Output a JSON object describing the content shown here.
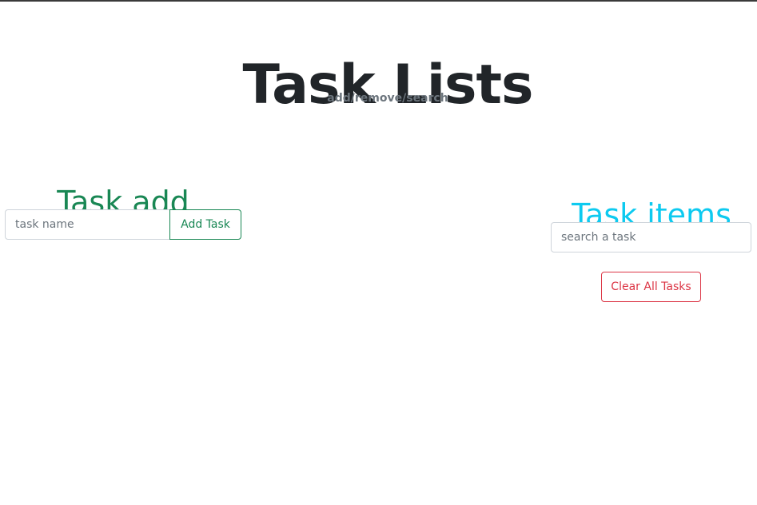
{
  "header": {
    "title": "Task Lists",
    "subtitle": "add/remove/search"
  },
  "add_section": {
    "title": "Task add",
    "input_placeholder": "task name",
    "input_value": "",
    "button_label": "Add Task"
  },
  "items_section": {
    "title": "Task items",
    "search_placeholder": "search a task",
    "search_value": "",
    "clear_button_label": "Clear All Tasks",
    "tasks": []
  },
  "colors": {
    "title": "#212529",
    "subtitle": "#6c757d",
    "success": "#198754",
    "info": "#0dcaf0",
    "danger": "#dc3545"
  }
}
